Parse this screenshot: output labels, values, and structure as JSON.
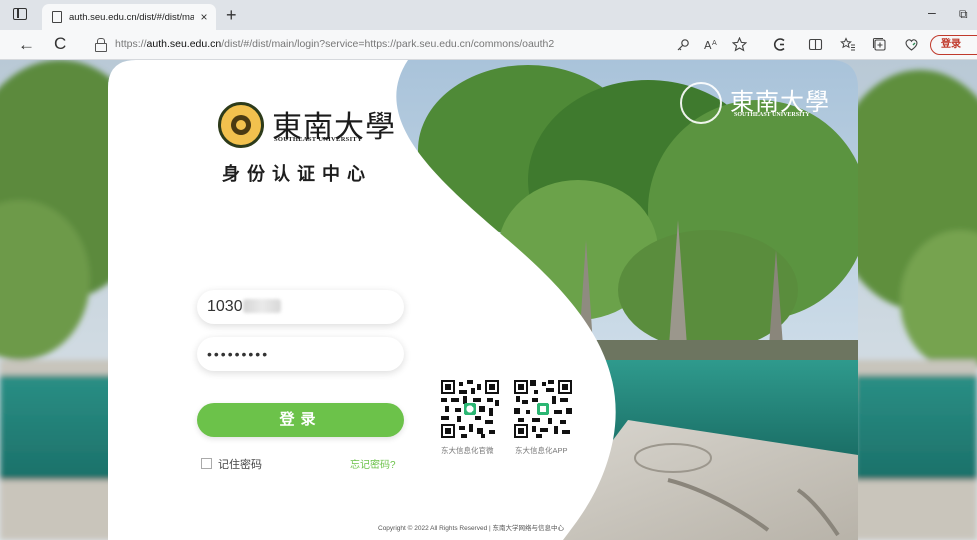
{
  "browser": {
    "tab_title": "auth.seu.edu.cn/dist/#/dist/main",
    "tab_close": "×",
    "new_tab": "+",
    "window_minimize": "–",
    "window_restore": "⧉",
    "back": "←",
    "refresh": "C",
    "url_prefix": "https://",
    "url_host": "auth.seu.edu.cn",
    "url_rest": "/dist/#/dist/main/login?service=https://park.seu.edu.cn/commons/oauth2",
    "toolbar_icons": [
      "key-icon",
      "read-aloud-icon",
      "favorite-star-icon",
      "copilot-icon",
      "split-screen-icon",
      "favorites-icon",
      "collections-icon",
      "extensions-icon"
    ],
    "profile_button": "登录"
  },
  "login": {
    "logo_cn": "東南大學",
    "logo_en": "SOUTHEAST UNIVERSITY",
    "title": "身份认证中心",
    "username_value": "1030",
    "password_value": "•••••••••",
    "login_button": "登录",
    "remember_label": "记住密码",
    "forgot_link": "忘记密码?",
    "qr_official": "东大信息化官微",
    "qr_app": "东大信息化APP",
    "copyright": "Copyright © 2022 All Rights Reserved | 东南大学网络与信息中心"
  },
  "hero": {
    "logo_cn": "東南大學",
    "logo_en": "SOUTHEAST UNIVERSITY"
  },
  "colors": {
    "accent_green": "#6cc24a",
    "chrome_bg": "#dfe3e8",
    "addr_bg": "#f7f8f9",
    "profile_red": "#c0392b"
  }
}
